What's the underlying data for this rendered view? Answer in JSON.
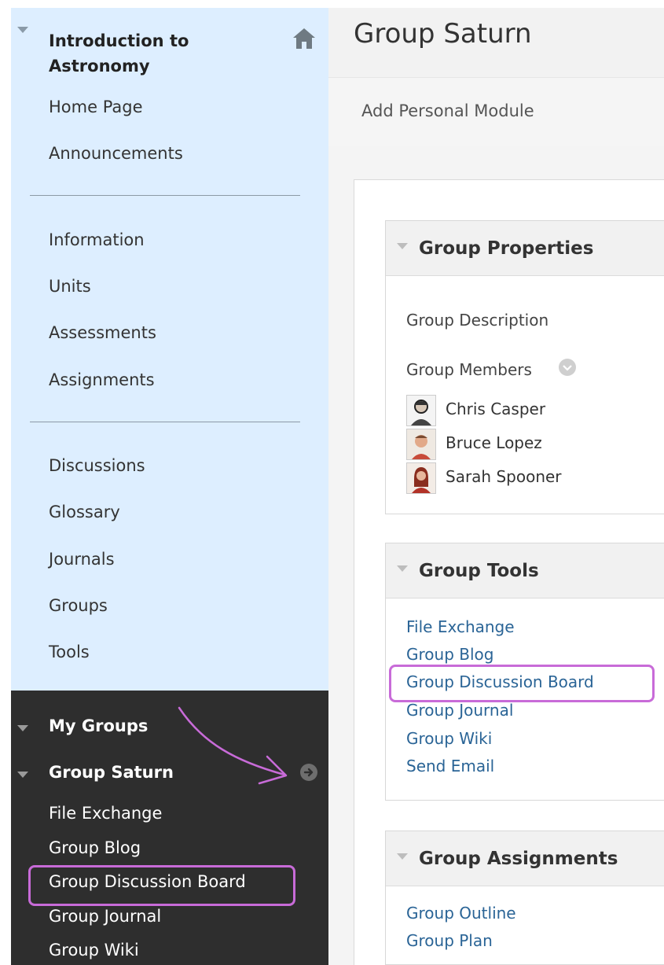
{
  "sidebar": {
    "course_title": "Introduction to Astronomy",
    "home_icon": "home-icon",
    "items": [
      {
        "label": "Home Page"
      },
      {
        "label": "Announcements"
      },
      {
        "label": "Information"
      },
      {
        "label": "Units"
      },
      {
        "label": "Assessments"
      },
      {
        "label": "Assignments"
      },
      {
        "label": "Discussions"
      },
      {
        "label": "Glossary"
      },
      {
        "label": "Journals"
      },
      {
        "label": "Groups"
      },
      {
        "label": "Tools"
      }
    ],
    "my_groups": {
      "heading": "My Groups",
      "group_name": "Group Saturn",
      "tools": [
        {
          "label": "File Exchange"
        },
        {
          "label": "Group Blog"
        },
        {
          "label": "Group Discussion Board"
        },
        {
          "label": "Group Journal"
        },
        {
          "label": "Group Wiki"
        }
      ]
    }
  },
  "header": {
    "title": "Group Saturn",
    "add_module": "Add Personal Module"
  },
  "group_properties": {
    "title": "Group Properties",
    "description_label": "Group Description",
    "members_label": "Group Members",
    "members": [
      {
        "name": "Chris Casper"
      },
      {
        "name": "Bruce Lopez"
      },
      {
        "name": "Sarah Spooner"
      }
    ]
  },
  "group_tools": {
    "title": "Group Tools",
    "links": [
      {
        "label": "File Exchange"
      },
      {
        "label": "Group Blog"
      },
      {
        "label": "Group Discussion Board"
      },
      {
        "label": "Group Journal"
      },
      {
        "label": "Group Wiki"
      },
      {
        "label": "Send Email"
      }
    ]
  },
  "group_assignments": {
    "title": "Group Assignments",
    "links": [
      {
        "label": "Group Outline"
      },
      {
        "label": "Group Plan"
      }
    ]
  },
  "colors": {
    "sidebar_bg": "#ddeeff",
    "dark_bg": "#2e2e2e",
    "link": "#2a6496",
    "highlight": "#c86bd8"
  }
}
